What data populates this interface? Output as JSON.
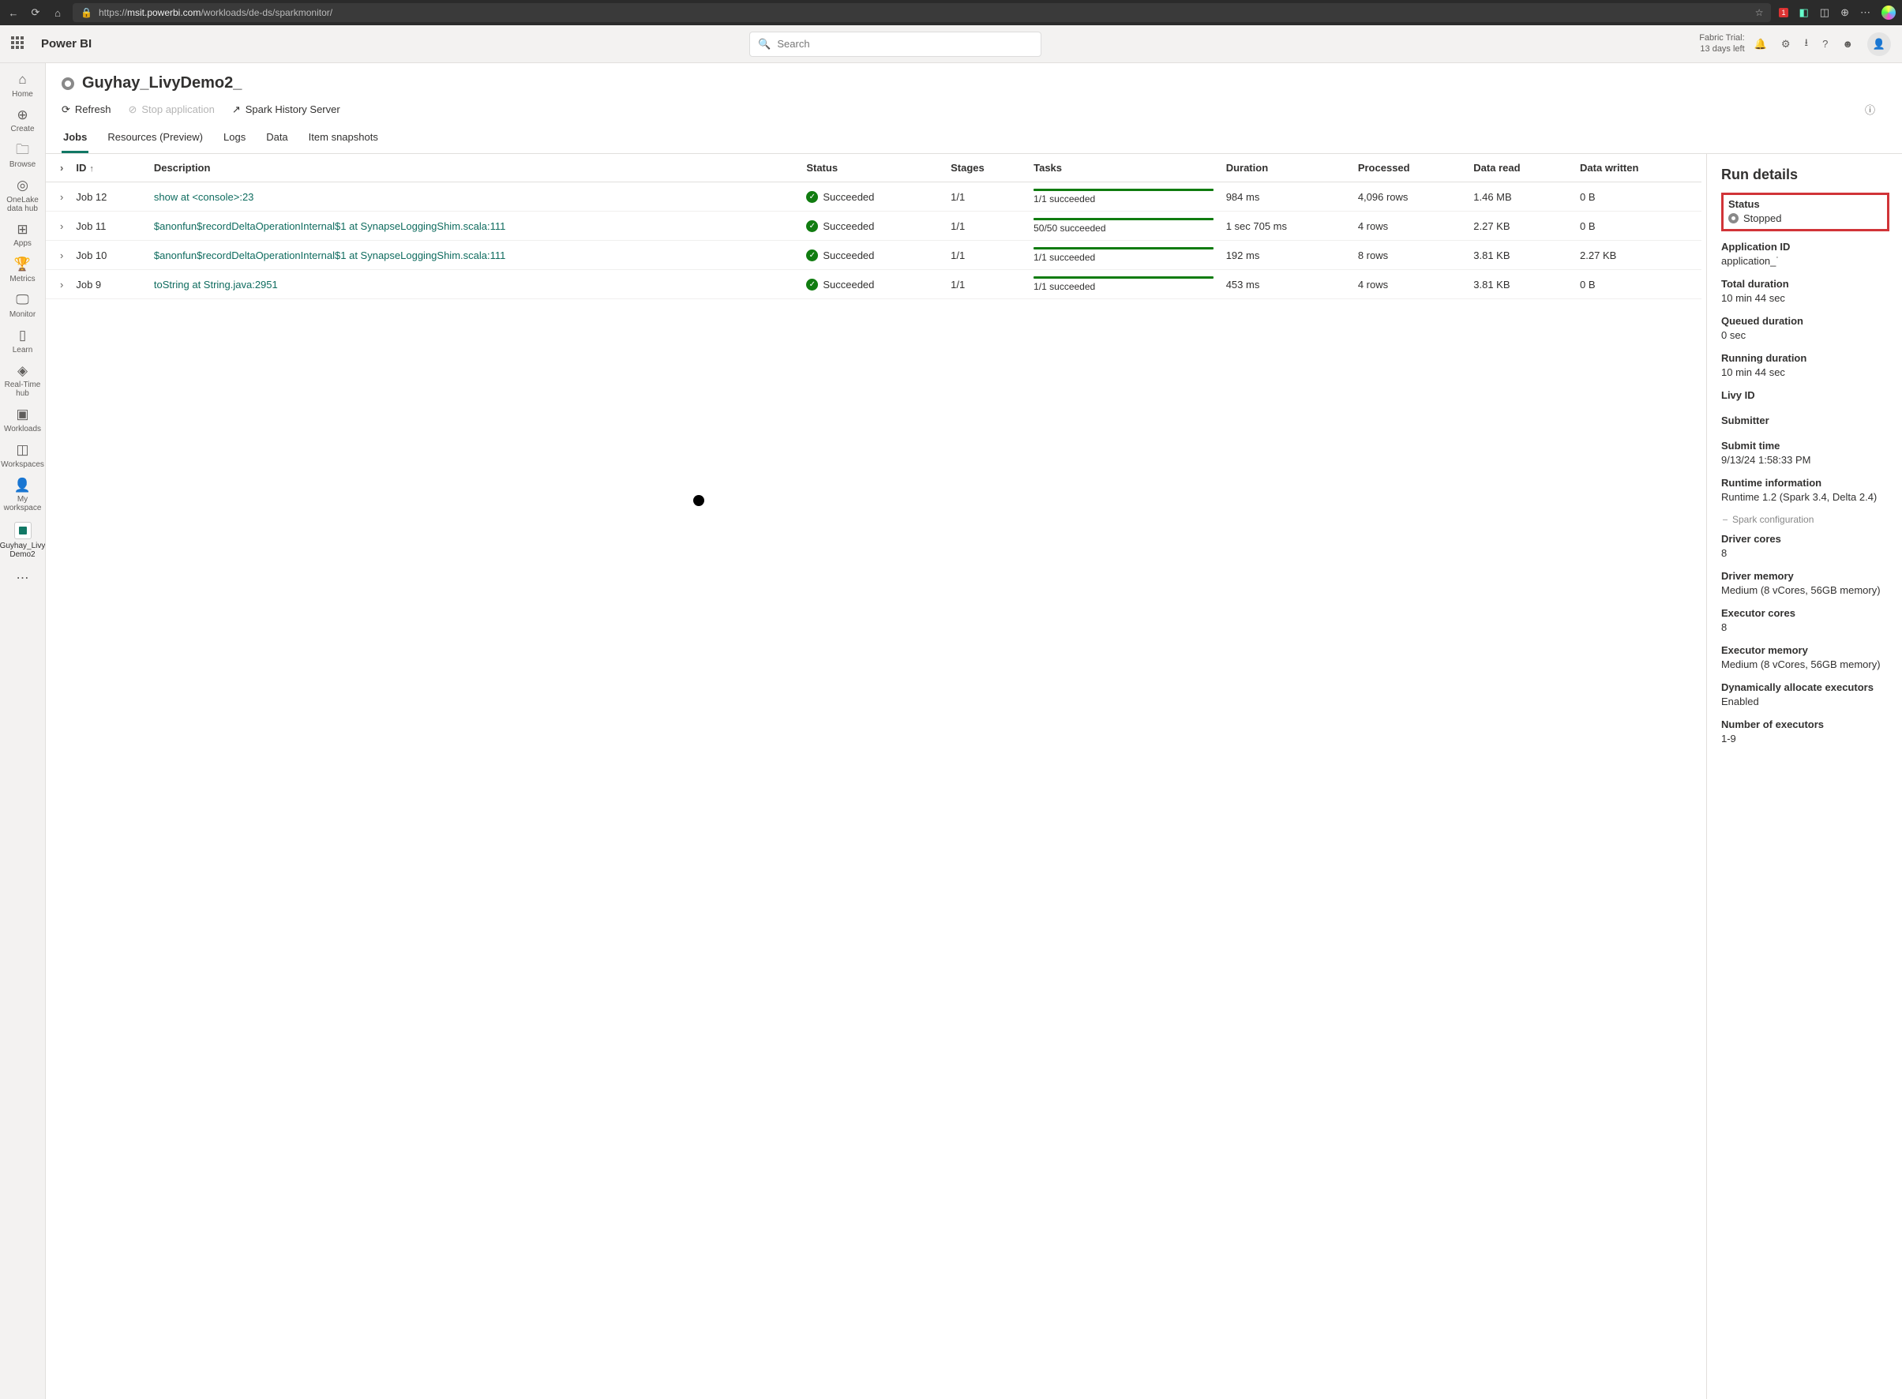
{
  "browser": {
    "url_host": "msit.powerbi.com",
    "url_path": "/workloads/de-ds/sparkmonitor/",
    "ext_badge": "1"
  },
  "appbar": {
    "brand": "Power BI",
    "search_placeholder": "Search",
    "trial_line1": "Fabric Trial:",
    "trial_line2": "13 days left"
  },
  "leftnav": {
    "items": [
      {
        "label": "Home"
      },
      {
        "label": "Create"
      },
      {
        "label": "Browse"
      },
      {
        "label": "OneLake data hub"
      },
      {
        "label": "Apps"
      },
      {
        "label": "Metrics"
      },
      {
        "label": "Monitor"
      },
      {
        "label": "Learn"
      },
      {
        "label": "Real-Time hub"
      },
      {
        "label": "Workloads"
      },
      {
        "label": "Workspaces"
      },
      {
        "label": "My workspace"
      },
      {
        "label": "Guyhay_Livy Demo2"
      }
    ]
  },
  "page": {
    "title": "Guyhay_LivyDemo2_",
    "actions": {
      "refresh": "Refresh",
      "stop": "Stop application",
      "history": "Spark History Server"
    },
    "tabs": [
      "Jobs",
      "Resources (Preview)",
      "Logs",
      "Data",
      "Item snapshots"
    ]
  },
  "table": {
    "headers": {
      "id": "ID",
      "description": "Description",
      "status": "Status",
      "stages": "Stages",
      "tasks": "Tasks",
      "duration": "Duration",
      "processed": "Processed",
      "data_read": "Data read",
      "data_written": "Data written"
    },
    "rows": [
      {
        "id": "Job 12",
        "desc": "show at <console>:23",
        "status": "Succeeded",
        "stages": "1/1",
        "tasks": "1/1 succeeded",
        "duration": "984 ms",
        "processed": "4,096 rows",
        "read": "1.46 MB",
        "written": "0 B"
      },
      {
        "id": "Job 11",
        "desc": "$anonfun$recordDeltaOperationInternal$1 at SynapseLoggingShim.scala:111",
        "status": "Succeeded",
        "stages": "1/1",
        "tasks": "50/50 succeeded",
        "duration": "1 sec 705 ms",
        "processed": "4 rows",
        "read": "2.27 KB",
        "written": "0 B"
      },
      {
        "id": "Job 10",
        "desc": "$anonfun$recordDeltaOperationInternal$1 at SynapseLoggingShim.scala:111",
        "status": "Succeeded",
        "stages": "1/1",
        "tasks": "1/1 succeeded",
        "duration": "192 ms",
        "processed": "8 rows",
        "read": "3.81 KB",
        "written": "2.27 KB"
      },
      {
        "id": "Job 9",
        "desc": "toString at String.java:2951",
        "status": "Succeeded",
        "stages": "1/1",
        "tasks": "1/1 succeeded",
        "duration": "453 ms",
        "processed": "4 rows",
        "read": "3.81 KB",
        "written": "0 B"
      }
    ]
  },
  "details": {
    "heading": "Run details",
    "status_label": "Status",
    "status_value": "Stopped",
    "app_id_label": "Application ID",
    "app_id_value": "application_˙",
    "total_duration_label": "Total duration",
    "total_duration_value": "10 min 44 sec",
    "queued_label": "Queued duration",
    "queued_value": "0 sec",
    "running_label": "Running duration",
    "running_value": "10 min 44 sec",
    "livy_label": "Livy ID",
    "submitter_label": "Submitter",
    "submit_time_label": "Submit time",
    "submit_time_value": "9/13/24 1:58:33 PM",
    "runtime_label": "Runtime information",
    "runtime_value": "Runtime 1.2 (Spark 3.4, Delta 2.4)",
    "spark_config": "Spark configuration",
    "driver_cores_label": "Driver cores",
    "driver_cores_value": "8",
    "driver_mem_label": "Driver memory",
    "driver_mem_value": "Medium (8 vCores, 56GB memory)",
    "exec_cores_label": "Executor cores",
    "exec_cores_value": "8",
    "exec_mem_label": "Executor memory",
    "exec_mem_value": "Medium (8 vCores, 56GB memory)",
    "dyn_label": "Dynamically allocate executors",
    "dyn_value": "Enabled",
    "num_exec_label": "Number of executors",
    "num_exec_value": "1-9"
  }
}
